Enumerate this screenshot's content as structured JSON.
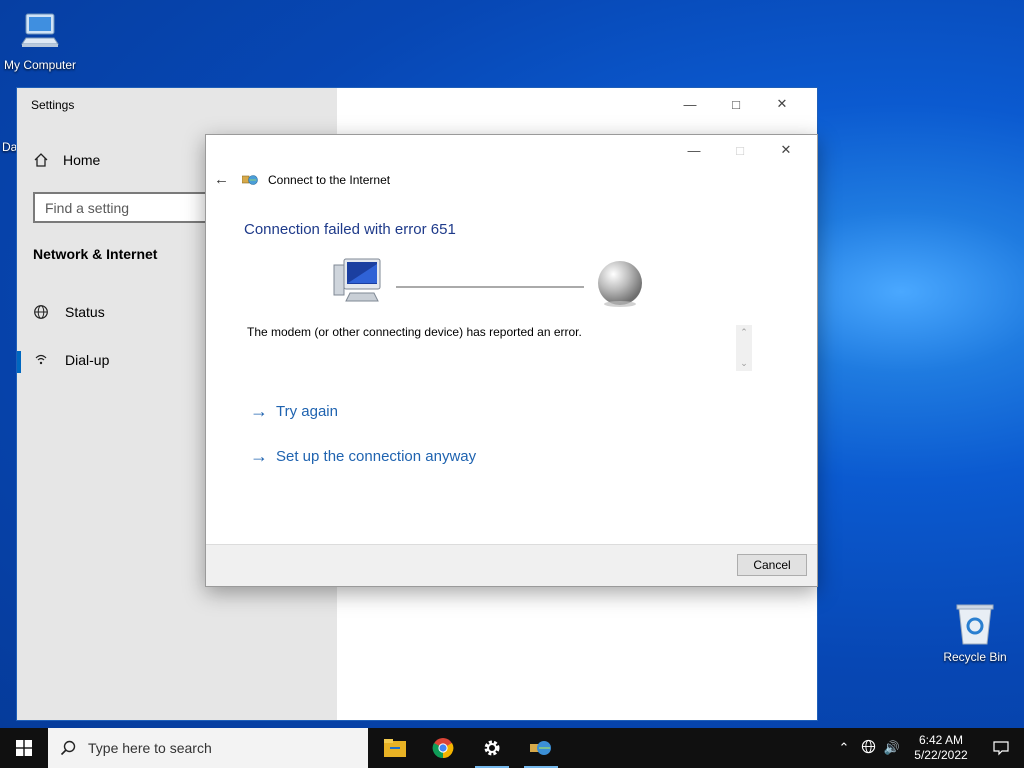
{
  "desktop": {
    "my_computer_label": "My Computer",
    "partial_icon_label": "Da",
    "recycle_bin_label": "Recycle Bin"
  },
  "settings_window": {
    "title": "Settings",
    "home_label": "Home",
    "search_placeholder": "Find a setting",
    "section_heading": "Network & Internet",
    "nav_items": [
      {
        "label": "Status",
        "icon": "globe-icon",
        "active": false
      },
      {
        "label": "Dial-up",
        "icon": "dialup-icon",
        "active": true
      }
    ]
  },
  "dialog": {
    "title": "Connect to the Internet",
    "heading": "Connection failed with error 651",
    "message": "The modem (or other connecting device) has reported an error.",
    "actions": [
      {
        "label": "Try again"
      },
      {
        "label": "Set up the connection anyway"
      }
    ],
    "cancel_label": "Cancel"
  },
  "taskbar": {
    "search_placeholder": "Type here to search",
    "apps": [
      "file-explorer-icon",
      "chrome-icon",
      "settings-gear-icon",
      "connect-internet-icon"
    ],
    "clock_time": "6:42 AM",
    "clock_date": "5/22/2022"
  },
  "colors": {
    "accent": "#0067c0",
    "link": "#1f63b0",
    "heading": "#1e3a8a"
  }
}
